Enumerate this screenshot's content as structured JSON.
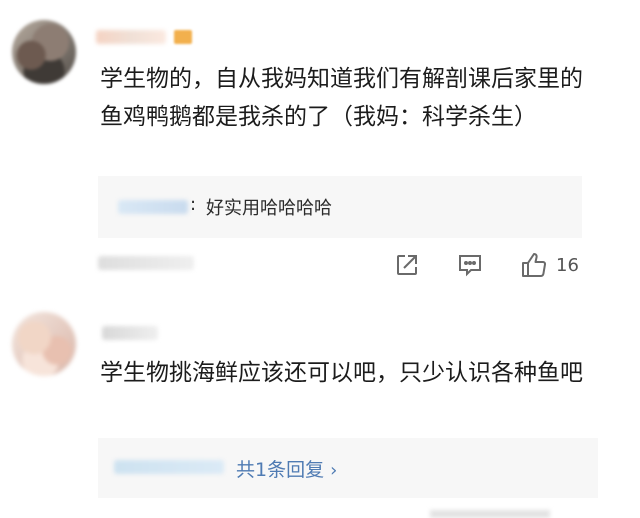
{
  "comments": [
    {
      "text": "学生物的，自从我妈知道我们有解剖课后家里的鱼鸡鸭鹅都是我杀的了（我妈：科学杀生）",
      "reply": {
        "colon": ":",
        "text": "好实用哈哈哈哈"
      },
      "actions": {
        "share_icon": "share-icon",
        "comment_icon": "comment-icon",
        "like_icon": "thumbs-up-icon",
        "likes": "16"
      }
    },
    {
      "text": "学生物挑海鲜应该还可以吧，只少认识各种鱼吧",
      "more_replies": {
        "label": "共1条回复",
        "chevron": "›"
      }
    }
  ],
  "colors": {
    "link": "#4f7bb3",
    "reply_bg": "#f7f7f7"
  }
}
